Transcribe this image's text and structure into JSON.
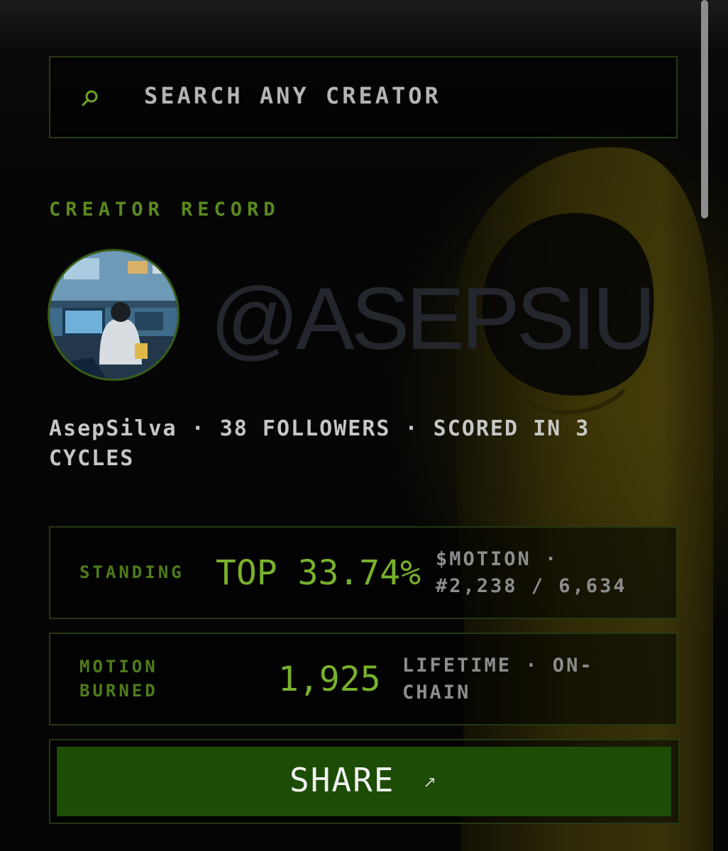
{
  "search": {
    "placeholder": "SEARCH ANY CREATOR",
    "icon": "search-icon"
  },
  "section_label": "CREATOR RECORD",
  "profile": {
    "handle": "@ASEPSIU",
    "avatar": "avatar",
    "meta": "AsepSilva · 38 FOLLOWERS · SCORED IN 3 CYCLES"
  },
  "standing": {
    "label": "STANDING",
    "value": "TOP 33.74%",
    "sub_line1": "$MOTION ·",
    "sub_line2": "#2,238 / 6,634"
  },
  "burned": {
    "label_line1": "MOTION",
    "label_line2": "BURNED",
    "value": "1,925",
    "sub_line1": "LIFETIME · ON-",
    "sub_line2": "CHAIN"
  },
  "share": {
    "label": "SHARE",
    "icon": "arrow-up-right-icon",
    "color": "#1d4c06"
  },
  "colors": {
    "accent": "#78b12c",
    "label_green": "#5a8a1e",
    "background": "#050505"
  }
}
